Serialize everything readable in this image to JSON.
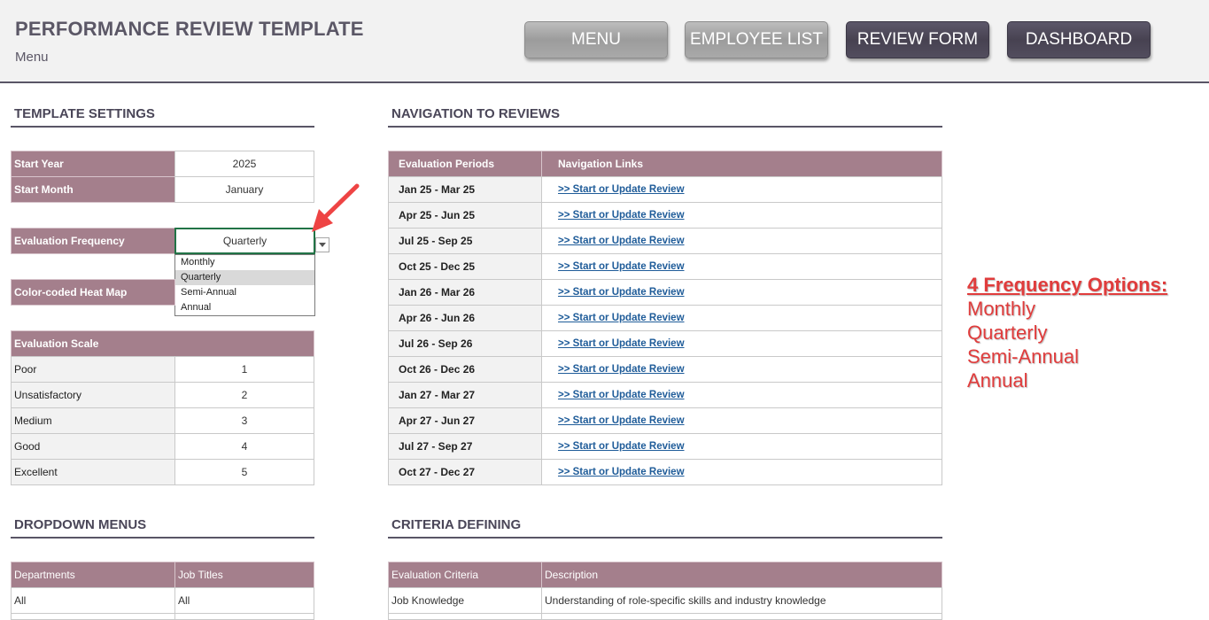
{
  "header": {
    "title": "PERFORMANCE REVIEW TEMPLATE",
    "subtitle": "Menu",
    "buttons": [
      "MENU",
      "EMPLOYEE LIST",
      "REVIEW FORM",
      "DASHBOARD"
    ]
  },
  "template_settings": {
    "title": "TEMPLATE SETTINGS",
    "start_year_label": "Start Year",
    "start_year": "2025",
    "start_month_label": "Start Month",
    "start_month": "January",
    "frequency_label": "Evaluation Frequency",
    "frequency": "Quarterly",
    "frequency_options": [
      "Monthly",
      "Quarterly",
      "Semi-Annual",
      "Annual"
    ],
    "heatmap_label": "Color-coded Heat Map",
    "scale_header": "Evaluation Scale",
    "scale": [
      {
        "label": "Poor",
        "value": "1"
      },
      {
        "label": "Unsatisfactory",
        "value": "2"
      },
      {
        "label": "Medium",
        "value": "3"
      },
      {
        "label": "Good",
        "value": "4"
      },
      {
        "label": "Excellent",
        "value": "5"
      }
    ]
  },
  "navigation": {
    "title": "NAVIGATION TO REVIEWS",
    "col_periods": "Evaluation Periods",
    "col_links": "Navigation Links",
    "link_text": ">> Start or Update Review",
    "periods": [
      "Jan 25 - Mar 25",
      "Apr 25 - Jun 25",
      "Jul 25 - Sep 25",
      "Oct 25 - Dec 25",
      "Jan 26 - Mar 26",
      "Apr 26 - Jun 26",
      "Jul 26 - Sep 26",
      "Oct 26 - Dec 26",
      "Jan 27 - Mar 27",
      "Apr 27 - Jun 27",
      "Jul 27 - Sep 27",
      "Oct 27 - Dec 27"
    ]
  },
  "dropdown_menus": {
    "title": "DROPDOWN MENUS",
    "col_departments": "Departments",
    "col_job_titles": "Job Titles",
    "department_first": "All",
    "job_title_first": "All"
  },
  "criteria": {
    "title": "CRITERIA DEFINING",
    "col_criteria": "Evaluation Criteria",
    "col_description": "Description",
    "first_criteria": "Job Knowledge",
    "first_description": "Understanding of role-specific skills and industry knowledge"
  },
  "annotation": {
    "title": "4 Frequency Options:",
    "items": [
      "Monthly",
      "Quarterly",
      "Semi-Annual",
      "Annual"
    ]
  },
  "colors": {
    "table_header": "#a47f8c",
    "button_dark": "#4e4a5a",
    "annotation": "#e03c3c"
  }
}
